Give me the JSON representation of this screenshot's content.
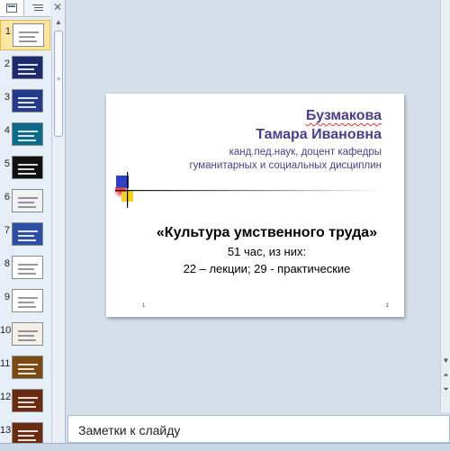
{
  "left_pane": {
    "tab_slides_icon": "slides-tab-icon",
    "tab_outline_icon": "outline-tab-icon",
    "close_glyph": "✕",
    "thumbnails": [
      {
        "num": "1",
        "bg": "#ffffff",
        "light": true
      },
      {
        "num": "2",
        "bg": "#1c2a6e",
        "light": false
      },
      {
        "num": "3",
        "bg": "#243a8a",
        "light": false
      },
      {
        "num": "4",
        "bg": "#0b6b8a",
        "light": false
      },
      {
        "num": "5",
        "bg": "#111111",
        "light": false
      },
      {
        "num": "6",
        "bg": "#f2f2f2",
        "light": true
      },
      {
        "num": "7",
        "bg": "#2d4fa3",
        "light": false
      },
      {
        "num": "8",
        "bg": "#ffffff",
        "light": true
      },
      {
        "num": "9",
        "bg": "#ffffff",
        "light": true
      },
      {
        "num": "10",
        "bg": "#f5f0e6",
        "light": true
      },
      {
        "num": "11",
        "bg": "#7a4a12",
        "light": false
      },
      {
        "num": "12",
        "bg": "#6a2c10",
        "light": false
      },
      {
        "num": "13",
        "bg": "#6a2c10",
        "light": false
      }
    ]
  },
  "slide": {
    "author_surname": "Бузмакова",
    "author_name": "Тамара Ивановна",
    "author_degree": "канд.пед.наук, доцент кафедры",
    "author_dept": "гуманитарных и социальных дисциплин",
    "title": "«Культура умственного труда»",
    "subtitle1": "51 час, из них:",
    "subtitle2": "22 – лекции; 29 - практические",
    "corner_mark_left": "1",
    "corner_mark_right": "1",
    "colors": {
      "author": "#4a3f8a",
      "square_blue": "#2e3fc8",
      "square_yellow": "#f5d21b",
      "square_red": "#e8323c"
    }
  },
  "notes": {
    "placeholder": "Заметки к слайду"
  }
}
